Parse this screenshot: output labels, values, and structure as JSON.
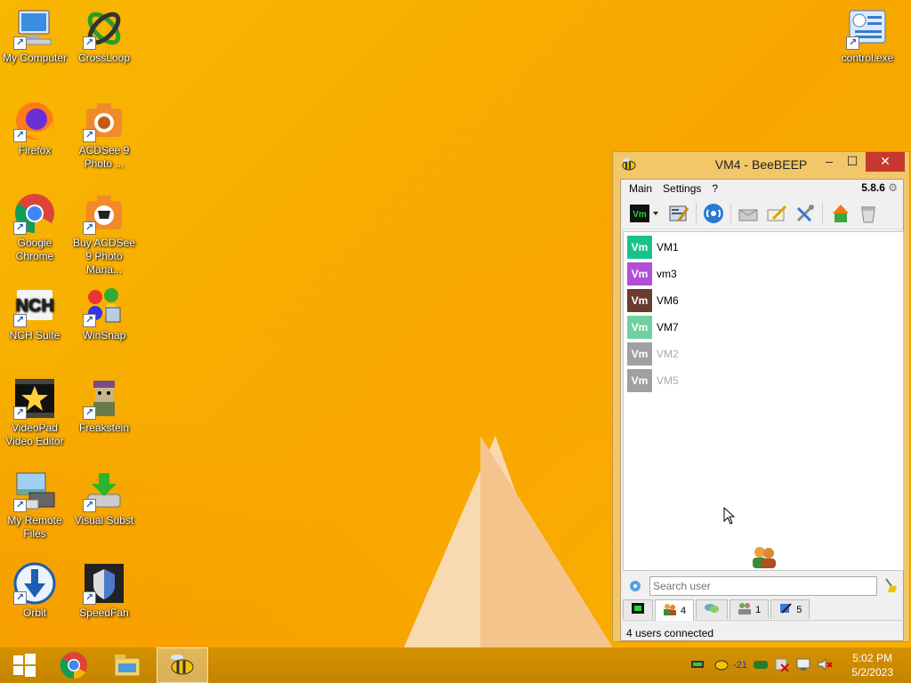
{
  "desktop_icons": [
    {
      "label": "My Computer",
      "icon": "computer-icon"
    },
    {
      "label": "CrossLoop",
      "icon": "crossloop-icon"
    },
    {
      "label": "Firefox",
      "icon": "firefox-icon"
    },
    {
      "label": "ACDSee 9 Photo ...",
      "icon": "acdsee-icon"
    },
    {
      "label": "Google Chrome",
      "icon": "chrome-icon"
    },
    {
      "label": "Buy ACDSee 9 Photo Mana...",
      "icon": "acdsee-buy-icon"
    },
    {
      "label": "NCH Suite",
      "icon": "nch-icon"
    },
    {
      "label": "WinSnap",
      "icon": "winsnap-icon"
    },
    {
      "label": "VideoPad Video Editor",
      "icon": "videopad-icon"
    },
    {
      "label": "Freakstein",
      "icon": "freakstein-icon"
    },
    {
      "label": "My Remote Files",
      "icon": "remote-files-icon"
    },
    {
      "label": "Visual Subst",
      "icon": "visual-subst-icon"
    },
    {
      "label": "Orbit",
      "icon": "orbit-icon"
    },
    {
      "label": "SpeedFan",
      "icon": "speedfan-icon"
    },
    {
      "label": "control.exe",
      "icon": "control-panel-icon"
    }
  ],
  "window": {
    "title": "VM4 - BeeBEEP",
    "menu": [
      "Main",
      "Settings",
      "?"
    ],
    "version": "5.8.6",
    "status_text": "4 users connected",
    "search_placeholder": "Search user"
  },
  "users": [
    {
      "avatar": "Vm",
      "name": "VM1",
      "color": "#19c28c",
      "online": true
    },
    {
      "avatar": "Vm",
      "name": "vm3",
      "color": "#b24fd6",
      "online": true
    },
    {
      "avatar": "Vm",
      "name": "VM6",
      "color": "#6b3b2e",
      "online": true
    },
    {
      "avatar": "Vm",
      "name": "VM7",
      "color": "#6fcfa0",
      "online": true
    },
    {
      "avatar": "Vm",
      "name": "VM2",
      "color": "#a0a0a0",
      "online": false
    },
    {
      "avatar": "Vm",
      "name": "VM5",
      "color": "#a0a0a0",
      "online": false
    }
  ],
  "tabs": [
    {
      "icon": "home-icon",
      "label": ""
    },
    {
      "icon": "users-icon",
      "label": "4"
    },
    {
      "icon": "chat-icon",
      "label": ""
    },
    {
      "icon": "group-icon",
      "label": "1"
    },
    {
      "icon": "share-icon",
      "label": "5"
    }
  ],
  "tray": {
    "time": "5:02 PM",
    "date": "5/2/2023",
    "temp": "21"
  }
}
